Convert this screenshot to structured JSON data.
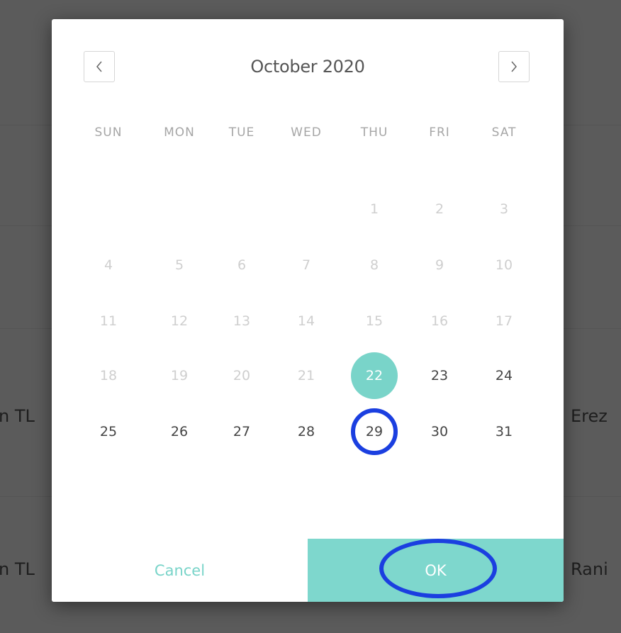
{
  "background": {
    "row1_left": "n TL",
    "row1_right": "Erez",
    "row2_left": "n TL",
    "row2_right": "Rani"
  },
  "calendar": {
    "month_label": "October 2020",
    "prev_icon": "chevron-left-icon",
    "next_icon": "chevron-right-icon",
    "weekdays": [
      "SUN",
      "MON",
      "TUE",
      "WED",
      "THU",
      "FRI",
      "SAT"
    ],
    "weeks": [
      [
        null,
        null,
        null,
        null,
        "1",
        "2",
        "3"
      ],
      [
        "4",
        "5",
        "6",
        "7",
        "8",
        "9",
        "10"
      ],
      [
        "11",
        "12",
        "13",
        "14",
        "15",
        "16",
        "17"
      ],
      [
        "18",
        "19",
        "20",
        "21",
        "22",
        "23",
        "24"
      ],
      [
        "25",
        "26",
        "27",
        "28",
        "29",
        "30",
        "31"
      ]
    ],
    "selected_day": "22",
    "first_enabled_day": 22,
    "highlighted_day": "29",
    "accent_color": "#79d4c9",
    "highlight_color": "#1b3fe0"
  },
  "actions": {
    "cancel_label": "Cancel",
    "ok_label": "OK"
  }
}
